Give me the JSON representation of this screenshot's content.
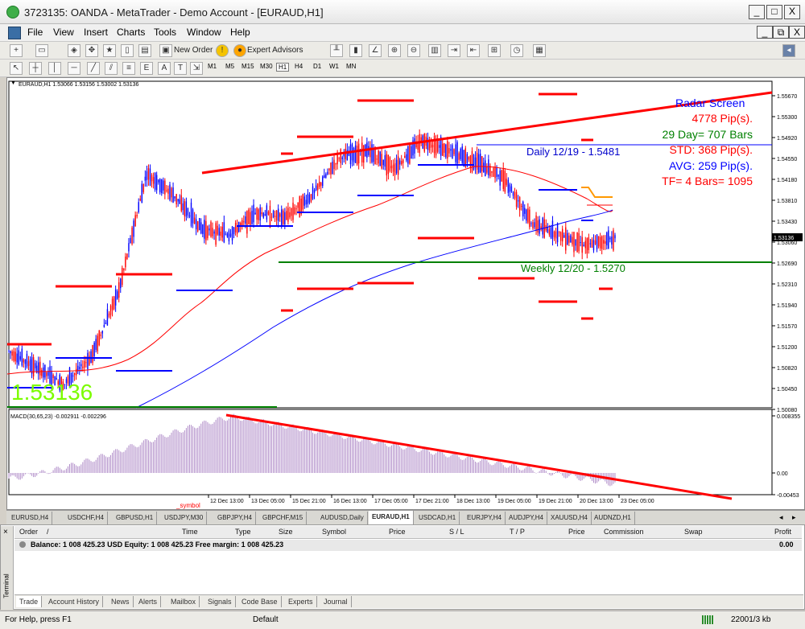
{
  "window": {
    "title": "3723135: OANDA - MetaTrader - Demo Account - [EURAUD,H1]",
    "min": "_",
    "max": "□",
    "close": "X"
  },
  "menu": [
    "File",
    "View",
    "Insert",
    "Charts",
    "Tools",
    "Window",
    "Help"
  ],
  "toolbar": {
    "new_order": "New Order",
    "expert_advisors": "Expert Advisors"
  },
  "timeframes": [
    "M1",
    "M5",
    "M15",
    "M30",
    "H1",
    "H4",
    "D1",
    "W1",
    "MN"
  ],
  "chart": {
    "header": "EURAUD,H1 1.53066 1.53156 1.53002 1.53136",
    "price_big": "1.53136",
    "current_price": "1.53136",
    "radar": [
      "Radar Screen",
      "4778 Pip(s).",
      "29 Day= 707 Bars",
      "STD: 368 Pip(s).",
      "AVG: 259 Pip(s).",
      "TF= 4 Bars= 1095"
    ],
    "daily_label": "Daily 12/19 - 1.5481",
    "weekly_label": "Weekly 12/20 - 1.5270",
    "symbol_label": "_symbol",
    "macd_header": "MACD(30,65,23) -0.002911 -0.002296",
    "colors": {
      "candle": "#0000ff",
      "bear": "#ff0000",
      "trend": "#ff0000",
      "ma_red": "#ff0000",
      "ma_blue": "#0000ff",
      "weekly": "#008000",
      "price_big": "#7cfc00",
      "macd": "#b08cc8"
    }
  },
  "chart_data": {
    "type": "line",
    "symbol": "EURAUD",
    "timeframe": "H1",
    "x": [
      "12 Dec 13:00",
      "13 Dec 05:00",
      "15 Dec 21:00",
      "16 Dec 13:00",
      "17 Dec 05:00",
      "17 Dec 21:00",
      "18 Dec 13:00",
      "19 Dec 05:00",
      "19 Dec 21:00",
      "20 Dec 13:00",
      "23 Dec 05:00"
    ],
    "y_ticks": [
      "1.55670",
      "1.55300",
      "1.54920",
      "1.54550",
      "1.54180",
      "1.53810",
      "1.53430",
      "1.53060",
      "1.52690",
      "1.52310",
      "1.51940",
      "1.51570",
      "1.51200",
      "1.50820",
      "1.50450",
      "1.50080"
    ],
    "macd_ticks": [
      "0.008355",
      "0.00",
      "-0.00453"
    ],
    "series": [
      {
        "values": [
          1.511,
          1.508,
          1.505,
          1.51,
          1.522,
          1.543,
          1.539,
          1.533,
          1.532,
          1.536,
          1.535,
          1.539,
          1.546,
          1.547,
          1.544,
          1.549,
          1.547,
          1.545,
          1.542,
          1.534,
          1.532,
          1.53,
          1.5314
        ]
      }
    ],
    "ylim": [
      1.5008,
      1.557
    ]
  },
  "symbol_tabs": [
    "EURUSD,H4",
    "USDCHF,H4",
    "GBPUSD,H1",
    "USDJPY,M30",
    "GBPJPY,H4",
    "GBPCHF,M15",
    "AUDUSD,Daily",
    "EURAUD,H1",
    "USDCAD,H1",
    "EURJPY,H4",
    "AUDJPY,H4",
    "XAUUSD,H4",
    "AUDNZD,H1"
  ],
  "terminal": {
    "columns": [
      "Order",
      "/",
      "Time",
      "Type",
      "Size",
      "Symbol",
      "Price",
      "S / L",
      "T / P",
      "Price",
      "Commission",
      "Swap",
      "Profit"
    ],
    "balance": "Balance: 1 008 425.23 USD  Equity: 1 008 425.23  Free margin: 1 008 425.23",
    "profit": "0.00",
    "side_label": "Terminal",
    "tabs": [
      "Trade",
      "Account History",
      "News",
      "Alerts",
      "Mailbox",
      "Signals",
      "Code Base",
      "Experts",
      "Journal"
    ]
  },
  "status": {
    "help": "For Help, press F1",
    "profile": "Default",
    "traffic": "22001/3 kb"
  }
}
